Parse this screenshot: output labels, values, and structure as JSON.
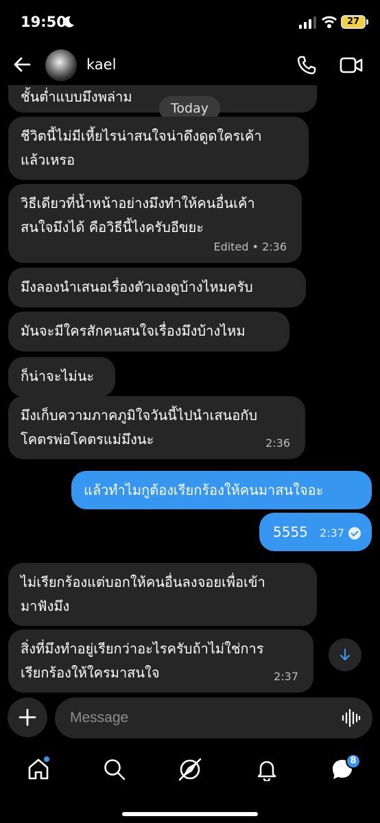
{
  "status_bar": {
    "time": "19:50",
    "battery": "27"
  },
  "header": {
    "contact_name": "kael"
  },
  "chat": {
    "day_label": "Today",
    "messages": [
      {
        "direction": "in",
        "lines": [
          "ชั้นต่ำแบบมึงพล่าม"
        ],
        "time": ""
      },
      {
        "direction": "in",
        "lines": [
          "ชีวิตนี้ไม่มีเหี้ยไรน่าสนใจน่าดึงดูดใครเค้า",
          "แล้วเหรอ"
        ],
        "time": ""
      },
      {
        "direction": "in",
        "lines": [
          "วิธีเดียวที่น้ำหน้าอย่างมึงทำให้คนอื่นเค้า",
          "สนใจมึงได้ คือวิธีนี้ไงครับอีขยะ"
        ],
        "time": "Edited • 2:36"
      },
      {
        "direction": "in",
        "lines": [
          "มึงลองนำเสนอเรื่องตัวเองดูบ้างไหมครับ"
        ],
        "time": ""
      },
      {
        "direction": "in",
        "lines": [
          "มันจะมีใครสักคนสนใจเรื่องมึงบ้างไหม"
        ],
        "time": ""
      },
      {
        "direction": "in",
        "lines": [
          "ก็น่าจะไม่นะ"
        ],
        "time": ""
      },
      {
        "direction": "in",
        "lines": [
          "มึงเก็บความภาคภูมิใจวันนี้ไปนำเสนอกับ",
          "โคตรพ่อโคตรแม่มึงนะ"
        ],
        "time": "2:36"
      },
      {
        "direction": "out",
        "lines": [
          "แล้วทำไมกูต้องเรียกร้องให้คนมาสนใจอะ"
        ],
        "time": ""
      },
      {
        "direction": "out",
        "lines": [
          "5555"
        ],
        "time": "2:37"
      },
      {
        "direction": "in",
        "lines": [
          "ไม่เรียกร้องแต่บอกให้คนอื่นลงจอยเพื่อเข้า",
          "มาฟังมึง"
        ],
        "time": ""
      },
      {
        "direction": "in",
        "lines": [
          "สิ่งที่มึงทำอยู่เรียกว่าอะไรครับถ้าไม่ใช่การ",
          "เรียกร้องให้ใครมาสนใจ"
        ],
        "time": "2:37"
      }
    ]
  },
  "composer": {
    "placeholder": "Message"
  },
  "nav": {
    "messages_badge": "8"
  },
  "colors": {
    "accent": "#3797f0",
    "bubble_in": "#262626",
    "background": "#000000"
  }
}
